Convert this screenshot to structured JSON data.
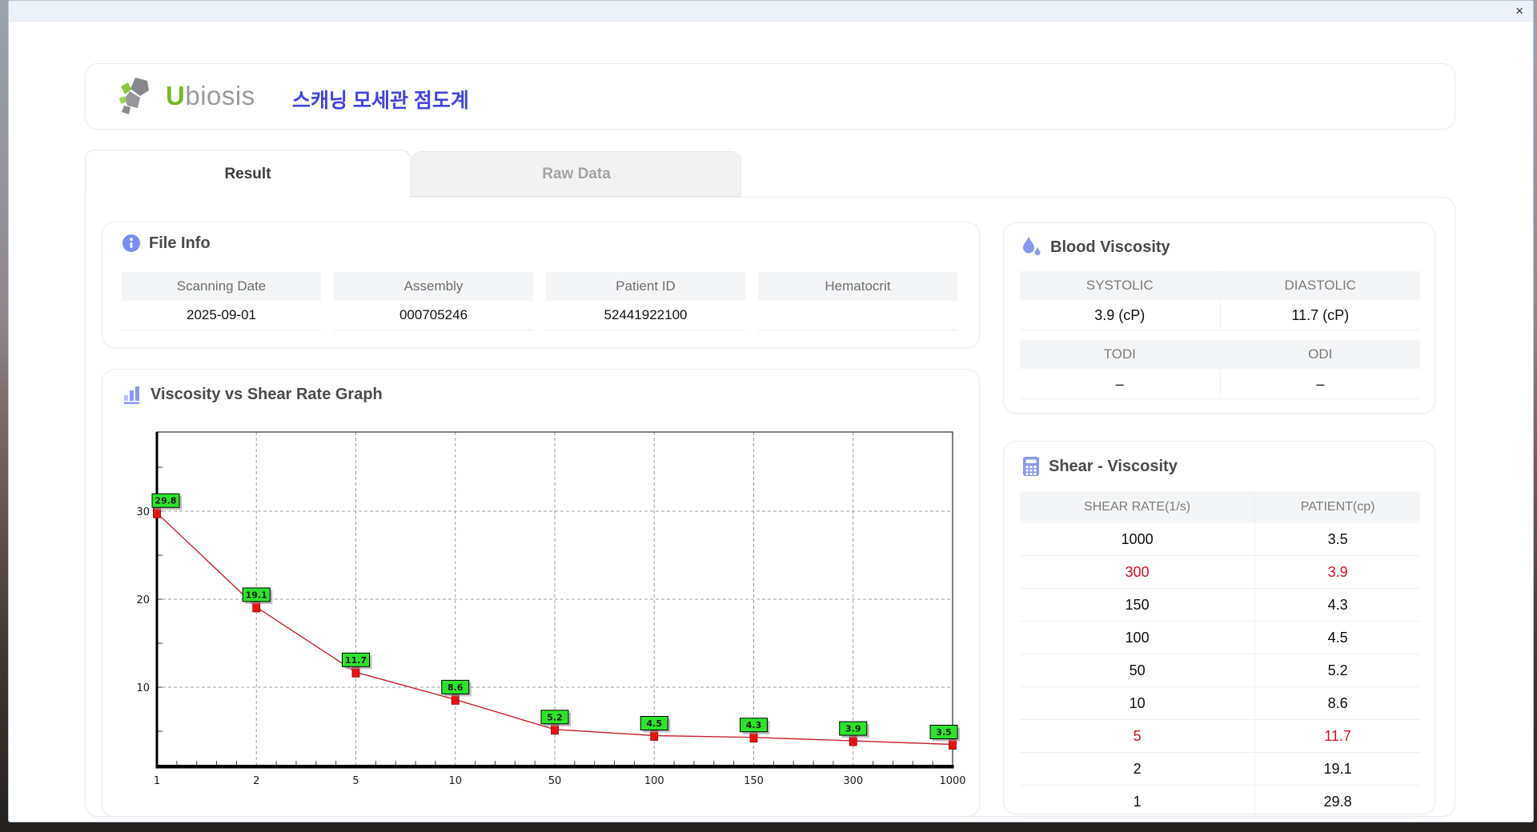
{
  "window": {
    "close_glyph": "×"
  },
  "header": {
    "brand_u": "U",
    "brand_rest": "biosis",
    "title_ko": "스캐닝 모세관 점도계"
  },
  "tabs": [
    {
      "label": "Result",
      "active": true
    },
    {
      "label": "Raw Data",
      "active": false
    }
  ],
  "file_info": {
    "title": "File Info",
    "fields": [
      {
        "label": "Scanning Date",
        "value": "2025-09-01"
      },
      {
        "label": "Assembly",
        "value": "000705246"
      },
      {
        "label": "Patient ID",
        "value": "52441922100"
      },
      {
        "label": "Hematocrit",
        "value": ""
      }
    ]
  },
  "blood_viscosity": {
    "title": "Blood Viscosity",
    "labels1": [
      "SYSTOLIC",
      "DIASTOLIC"
    ],
    "values1": [
      "3.9 (cP)",
      "11.7 (cP)"
    ],
    "labels2": [
      "TODI",
      "ODI"
    ],
    "values2": [
      "–",
      "–"
    ]
  },
  "graph": {
    "title": "Viscosity vs Shear Rate Graph"
  },
  "chart_data": {
    "type": "line",
    "title": "Viscosity vs Shear Rate Graph",
    "categories": [
      "1",
      "2",
      "5",
      "10",
      "50",
      "100",
      "150",
      "300",
      "1000"
    ],
    "values": [
      29.8,
      19.1,
      11.7,
      8.6,
      5.2,
      4.5,
      4.3,
      3.9,
      3.5
    ],
    "xlabel": "",
    "ylabel": "",
    "y_ticks": [
      10,
      20,
      30
    ],
    "ylim": [
      1,
      39
    ],
    "x_scale": "categorical-even",
    "grid": "dashed",
    "legend": false,
    "data_labels": true,
    "line_color": "#c82333",
    "marker_color": "#ee1111",
    "label_bg": "#2ce42c"
  },
  "shear_table": {
    "title": "Shear - Viscosity",
    "columns": [
      "SHEAR RATE(1/s)",
      "PATIENT(cp)"
    ],
    "rows": [
      {
        "rate": "1000",
        "patient": "3.5",
        "highlight": false
      },
      {
        "rate": "300",
        "patient": "3.9",
        "highlight": true
      },
      {
        "rate": "150",
        "patient": "4.3",
        "highlight": false
      },
      {
        "rate": "100",
        "patient": "4.5",
        "highlight": false
      },
      {
        "rate": "50",
        "patient": "5.2",
        "highlight": false
      },
      {
        "rate": "10",
        "patient": "8.6",
        "highlight": false
      },
      {
        "rate": "5",
        "patient": "11.7",
        "highlight": true
      },
      {
        "rate": "2",
        "patient": "19.1",
        "highlight": false
      },
      {
        "rate": "1",
        "patient": "29.8",
        "highlight": false
      }
    ]
  },
  "colors": {
    "accent_icon": "#7c8cf0",
    "highlight_red": "#cc1122",
    "title_blue": "#4343df",
    "logo_green": "#8dc63f",
    "logo_gray": "#9b9b9b",
    "label_green": "#2ce42c",
    "marker_red": "#ee1111",
    "line_red": "#c82333"
  }
}
